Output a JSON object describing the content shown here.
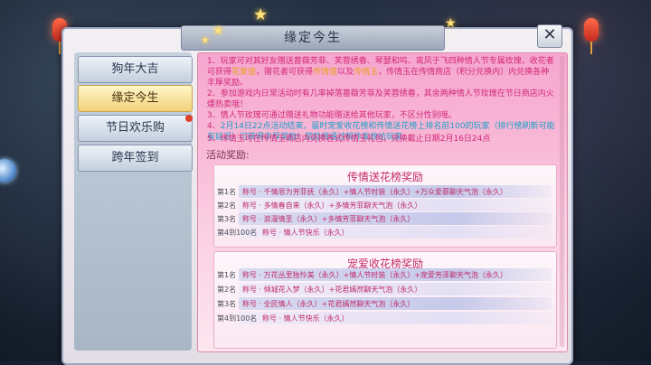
{
  "window": {
    "title": "缘定今生",
    "close_label": "✕"
  },
  "sidebar": {
    "items": [
      {
        "label": "狗年大吉",
        "active": false
      },
      {
        "label": "缘定今生",
        "active": true
      },
      {
        "label": "节日欢乐购",
        "active": false,
        "badge": true
      },
      {
        "label": "跨年签到",
        "active": false
      }
    ]
  },
  "rules": [
    {
      "num": "1、",
      "text": "玩家可对其好友赠送蔷薇芳菲、芙蓉绣春、琴瑟和鸣、鸾凤于飞四种情人节专属玫瑰，收花者可获得",
      "hl1": "花爱值",
      "mid": "，赠花者可获得",
      "hl2": "传情值",
      "mid2": "以及",
      "hl3": "传情玉",
      "tail": "，传情玉在传情商店（积分兑换内）内兑换各种丰厚奖励。"
    },
    {
      "num": "2、",
      "text": "参加游戏内日常活动时有几率掉落蔷薇芳菲及芙蓉绣春，其余两种情人节玫瑰在节日商店内火爆热卖哦！"
    },
    {
      "num": "3、",
      "text": "情人节玫瑰可通过赠送礼物功能赠送给其他玩家，不区分性别哦。"
    },
    {
      "num": "4、",
      "text": "2月14日22点活动结束，届时宠爱收花榜和传情送花榜上排名前100的玩家（排行榜刷新可能有延迟）可获得丰厚奖励！奖励将通过邮件发放给玩家。"
    },
    {
      "num": "5、",
      "text": "传情玉可在传情玉商店内兑换各式传情玉礼包，兑换截止日期2月16日24点"
    }
  ],
  "rewards_label": "活动奖励:",
  "send_board": {
    "title": "传情送花榜奖励",
    "rows": [
      {
        "rank": "第1名",
        "reward": "称号 · 千情恩为芳菲抚（永久）+情人节时装（永久）+万众爱慕聊天气泡（永久）"
      },
      {
        "rank": "第2名",
        "reward": "称号 · 多情春自来（永久）+多情芳菲聊天气泡（永久）"
      },
      {
        "rank": "第3名",
        "reward": "称号 · 浪漫情圣（永久）+多情芳菲聊天气泡（永久）"
      },
      {
        "rank": "第4到100名",
        "reward": "称号 · 情人节快乐（永久）"
      }
    ]
  },
  "receive_board": {
    "title": "宠爱收花榜奖励",
    "rows": [
      {
        "rank": "第1名",
        "reward": "称号 · 万花丛里独怜美（永久）+情人节时装（永久）+宠爱芳泽聊天气泡（永久）"
      },
      {
        "rank": "第2名",
        "reward": "称号 · 倾城花入梦（永久）+花君嫣然聊天气泡（永久）"
      },
      {
        "rank": "第3名",
        "reward": "称号 · 全民情人（永久）+花君嫣然聊天气泡（永久）"
      },
      {
        "rank": "第4到100名",
        "reward": "称号 · 情人节快乐（永久）"
      }
    ]
  }
}
